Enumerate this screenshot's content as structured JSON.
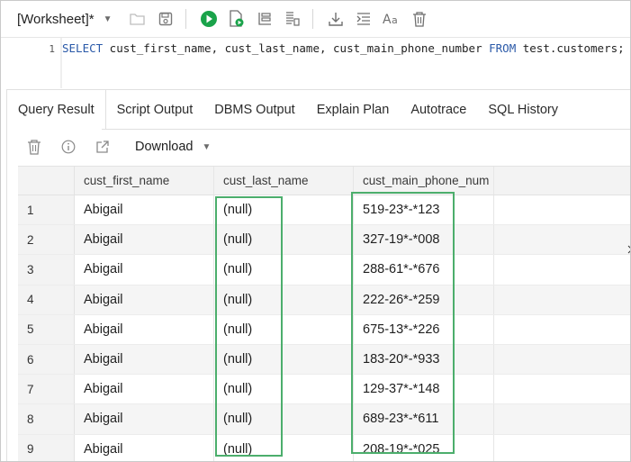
{
  "worksheet": {
    "label": "[Worksheet]*"
  },
  "toolbar": {
    "icons": [
      "folder-open-icon",
      "save-icon",
      "run-statement-icon",
      "run-script-icon",
      "explain-plan-icon",
      "autotrace-icon",
      "download-icon",
      "format-icon",
      "change-case-icon",
      "clear-icon"
    ],
    "run_color": "#1aa34a"
  },
  "editor": {
    "line_number": "1",
    "kw_select": "SELECT",
    "columns_text": " cust_first_name, cust_last_name, cust_main_phone_number ",
    "kw_from": "FROM",
    "table_text": " test.customers;"
  },
  "tabs": [
    "Query Result",
    "Script Output",
    "DBMS Output",
    "Explain Plan",
    "Autotrace",
    "SQL History"
  ],
  "result_toolbar": {
    "download_label": "Download"
  },
  "grid": {
    "columns": [
      "cust_first_name",
      "cust_last_name",
      "cust_main_phone_num"
    ],
    "rows": [
      [
        "1",
        "Abigail",
        "(null)",
        "519-23*-*123"
      ],
      [
        "2",
        "Abigail",
        "(null)",
        "327-19*-*008"
      ],
      [
        "3",
        "Abigail",
        "(null)",
        "288-61*-*676"
      ],
      [
        "4",
        "Abigail",
        "(null)",
        "222-26*-*259"
      ],
      [
        "5",
        "Abigail",
        "(null)",
        "675-13*-*226"
      ],
      [
        "6",
        "Abigail",
        "(null)",
        "183-20*-*933"
      ],
      [
        "7",
        "Abigail",
        "(null)",
        "129-37*-*148"
      ],
      [
        "8",
        "Abigail",
        "(null)",
        "689-23*-*611"
      ],
      [
        "9",
        "Abigail",
        "(null)",
        "208-19*-*025"
      ]
    ]
  },
  "highlight_color": "#4cae6c"
}
